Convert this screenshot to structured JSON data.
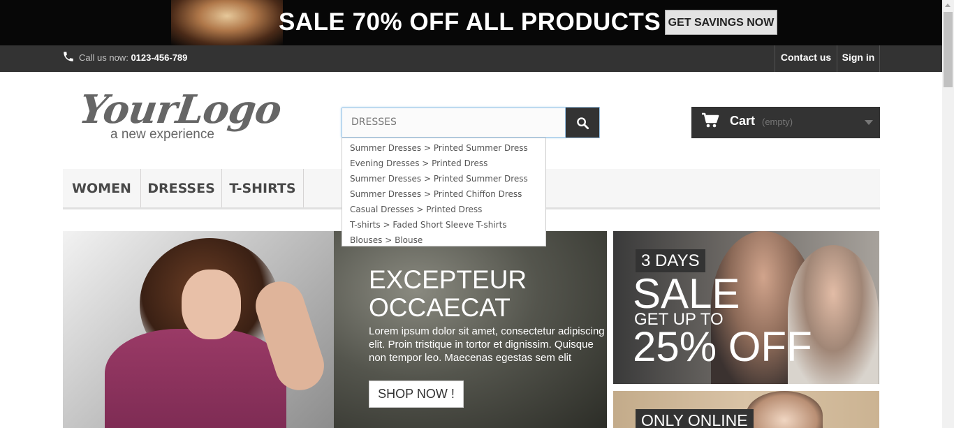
{
  "promo": {
    "text": "SALE 70% OFF ALL PRODUCTS",
    "button_label": "GET SAVINGS NOW"
  },
  "navbar": {
    "call_label": "Call us now:",
    "phone": "0123-456-789",
    "contact_label": "Contact us",
    "signin_label": "Sign in",
    "phone_icon": "phone-icon"
  },
  "header": {
    "logo_script": "YourLogo",
    "logo_tagline": "a new experience",
    "search": {
      "value": "DRESSES",
      "button_icon": "search-icon"
    },
    "autocomplete": [
      "Summer Dresses > Printed Summer Dress",
      "Evening Dresses > Printed Dress",
      "Summer Dresses > Printed Summer Dress",
      "Summer Dresses > Printed Chiffon Dress",
      "Casual Dresses > Printed Dress",
      "T-shirts > Faded Short Sleeve T-shirts",
      "Blouses > Blouse"
    ],
    "cart": {
      "label": "Cart",
      "status": "(empty)",
      "icon": "cart-icon"
    }
  },
  "menu": {
    "items": [
      "WOMEN",
      "DRESSES",
      "T-SHIRTS"
    ]
  },
  "slider": {
    "title_line1": "EXCEPTEUR",
    "title_line2": "OCCAECAT",
    "body": "Lorem ipsum dolor sit amet, consectetur adipiscing elit. Proin tristique in tortor et dignissim. Quisque non tempor leo. Maecenas egestas sem elit",
    "button_label": "SHOP NOW !"
  },
  "banners": {
    "b1_days": "3 DAYS",
    "b1_sale": "SALE",
    "b1_getup": "GET UP TO",
    "b1_off": "25% OFF",
    "b2_label": "ONLY ONLINE"
  },
  "colors": {
    "dark": "#333333",
    "promo_bg": "#070707",
    "menu_bg": "#f6f6f6",
    "focus": "#9cc6e8"
  }
}
